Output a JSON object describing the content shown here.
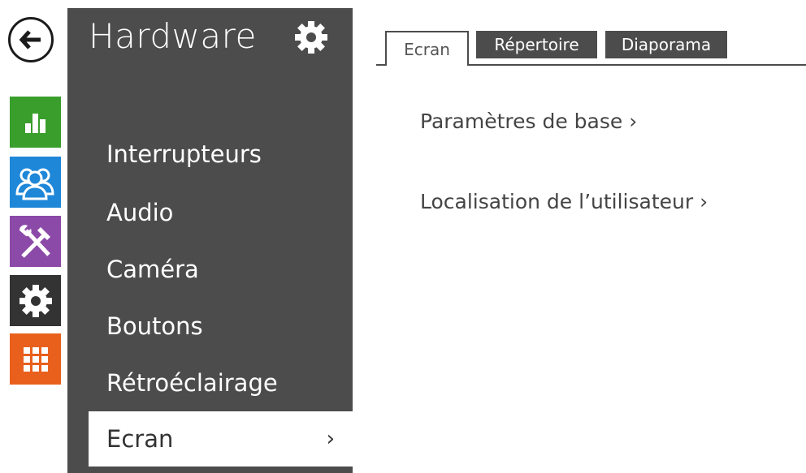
{
  "rail": {
    "back_icon": "arrow-left-icon",
    "tiles": [
      {
        "name": "status",
        "icon": "bar-chart-icon",
        "color": "#3a9e2c"
      },
      {
        "name": "directory",
        "icon": "users-icon",
        "color": "#1f87d8"
      },
      {
        "name": "services",
        "icon": "tools-icon",
        "color": "#8c4aa8"
      },
      {
        "name": "hardware",
        "icon": "gear-icon",
        "color": "#333333"
      },
      {
        "name": "system",
        "icon": "grid-icon",
        "color": "#e8601c"
      }
    ]
  },
  "panel": {
    "title": "Hardware",
    "gear_icon": "gear-icon",
    "menu": [
      {
        "label": "Interrupteurs",
        "active": false
      },
      {
        "label": "Audio",
        "active": false
      },
      {
        "label": "Caméra",
        "active": false
      },
      {
        "label": "Boutons",
        "active": false
      },
      {
        "label": "Rétroéclairage",
        "active": false
      },
      {
        "label": "Ecran",
        "active": true,
        "chevron": "›"
      }
    ]
  },
  "tabs": [
    {
      "label": "Ecran",
      "active": true
    },
    {
      "label": "Répertoire",
      "active": false
    },
    {
      "label": "Diaporama",
      "active": false
    }
  ],
  "content": {
    "links": [
      {
        "label": "Paramètres de base ›"
      },
      {
        "label": "Localisation de l’utilisateur ›"
      }
    ]
  },
  "colors": {
    "panel_bg": "#4c4c4c",
    "text_dark": "#444444"
  }
}
